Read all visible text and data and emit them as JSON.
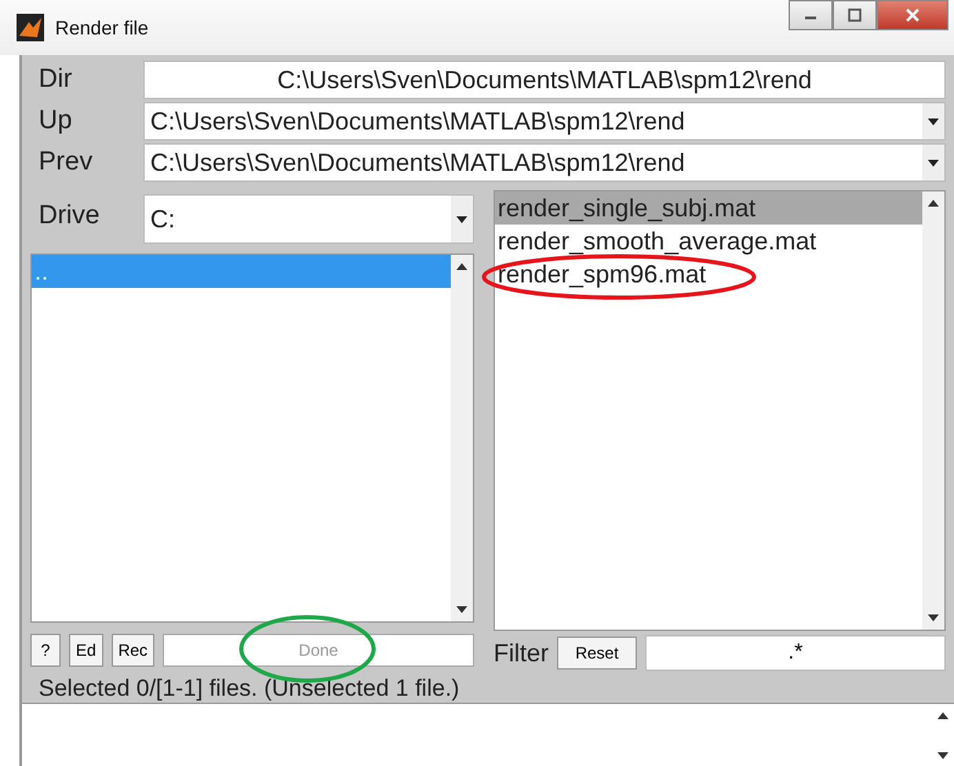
{
  "window": {
    "title": "Render file"
  },
  "dir": {
    "label": "Dir",
    "value": "C:\\Users\\Sven\\Documents\\MATLAB\\spm12\\rend"
  },
  "up": {
    "label": "Up",
    "value": "C:\\Users\\Sven\\Documents\\MATLAB\\spm12\\rend"
  },
  "prev": {
    "label": "Prev",
    "value": "C:\\Users\\Sven\\Documents\\MATLAB\\spm12\\rend"
  },
  "drive": {
    "label": "Drive",
    "value": "C:"
  },
  "directories": [
    {
      "name": "..",
      "selected": true
    }
  ],
  "files": [
    {
      "name": "render_single_subj.mat",
      "selected": true
    },
    {
      "name": "render_smooth_average.mat",
      "selected": false
    },
    {
      "name": "render_spm96.mat",
      "selected": false,
      "annotation": {
        "color": "#e8141c"
      }
    }
  ],
  "buttons": [
    {
      "label": "?"
    },
    {
      "label": "Ed"
    },
    {
      "label": "Rec"
    }
  ],
  "done": {
    "label": "Done",
    "disabled": true,
    "annotation": {
      "color": "#1fa84a"
    }
  },
  "filter": {
    "label": "Filter",
    "reset": "Reset",
    "value": ".*"
  },
  "status": "Selected 0/[1-1] files. (Unselected 1 file.)"
}
